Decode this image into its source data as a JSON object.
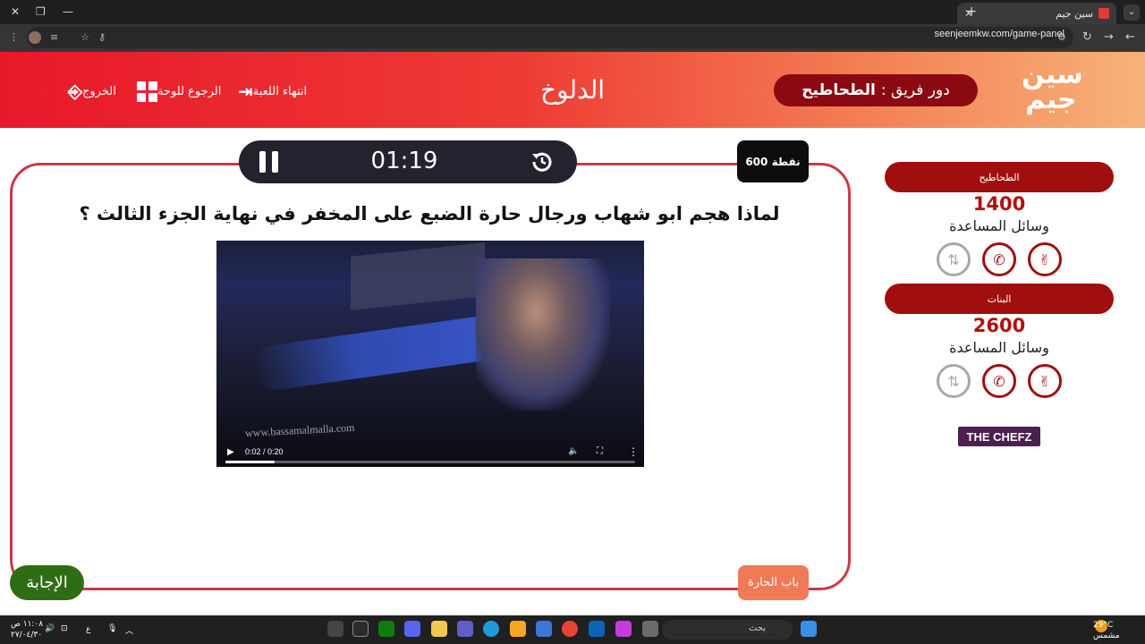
{
  "browser": {
    "tab_title": "سين جيم",
    "url": "seenjeemkw.com/game-panel",
    "new_tab": "+",
    "close_tab": "✕"
  },
  "header": {
    "logo_text": "سين جيم",
    "turn_prefix": "دور فريق :",
    "turn_team": "الطحاطيح",
    "category": "الدلوخ",
    "nav_end_game": "انتهاء اللعبة",
    "nav_back_board": "الرجوع للوحة",
    "nav_exit": "الخروج"
  },
  "question": {
    "timer": "01:19",
    "points": "600 نقطة",
    "text": "لماذا هجم ابو شهاب ورجال حارة الضبع على المخفر في نهاية الجزء الثالث ؟",
    "answer_label": "الإجابة",
    "door_label": "باب الحارة"
  },
  "video": {
    "watermark": "www.bassamalmalla.com",
    "time": "0:02 / 0:20",
    "progress": 0.12
  },
  "teams": [
    {
      "name": "الطحاطيح",
      "score": "1400",
      "help_label": "وسائل المساعدة"
    },
    {
      "name": "البنات",
      "score": "2600",
      "help_label": "وسائل المساعدة"
    }
  ],
  "sponsor": "THE CHEFZ",
  "taskbar": {
    "search_placeholder": "بحث",
    "weather_temp": "29°C",
    "weather_desc": "مشمس",
    "clock_time": "١١:٠٨ ص",
    "clock_date": "٢٧/٠٤/٣٠",
    "lang": "ع"
  },
  "colors": {
    "header_start": "#e8182b",
    "header_end": "#f7b27a",
    "team_pill": "#a10e0e",
    "answer_button": "#2f6d14",
    "door_button": "#f07a55",
    "frame_border": "#c93a47"
  }
}
